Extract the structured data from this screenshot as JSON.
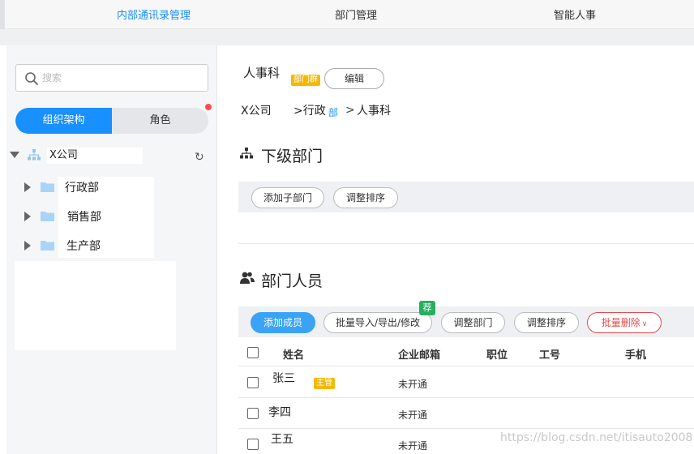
{
  "top_nav": {
    "items": [
      {
        "label": "内部通讯录管理",
        "active": true
      },
      {
        "label": "部门管理",
        "active": false
      },
      {
        "label": "智能人事",
        "active": false
      }
    ]
  },
  "sidebar": {
    "search_placeholder": "搜索",
    "segment": {
      "active": "组织架构",
      "inactive": "角色"
    },
    "tree": {
      "root": "X公司",
      "children": [
        "行政部",
        "销售部",
        "生产部"
      ]
    }
  },
  "main": {
    "dept_name": "人事科",
    "dept_tag": "部门群",
    "edit_label": "编辑",
    "breadcrumb": {
      "company": "X公司",
      "mid": ">行政",
      "mid_blue": "部",
      "sep": ">",
      "current": "人事科"
    },
    "sub_section": {
      "title": "下级部门",
      "buttons": [
        "添加子部门",
        "调整排序"
      ]
    },
    "members_section": {
      "title": "部门人员",
      "buttons": {
        "add": "添加成员",
        "batch": "批量导入/导出/修改",
        "adjust_dept": "调整部门",
        "adjust_order": "调整排序",
        "batch_delete": "批量删除"
      },
      "recommend_badge": "荐",
      "columns": [
        "姓名",
        "企业邮箱",
        "职位",
        "工号",
        "手机"
      ],
      "rows": [
        {
          "name": "张三",
          "tag": "主管",
          "email": "未开通"
        },
        {
          "name": "李四",
          "tag": "",
          "email": "未开通"
        },
        {
          "name": "王五",
          "tag": "",
          "email": "未开通"
        }
      ]
    }
  },
  "watermark": "https://blog.csdn.net/itisauto2008",
  "colors": {
    "accent": "#1890ff",
    "tag": "#f5b800",
    "danger": "#e84a4a",
    "recommend": "#27ae60"
  }
}
